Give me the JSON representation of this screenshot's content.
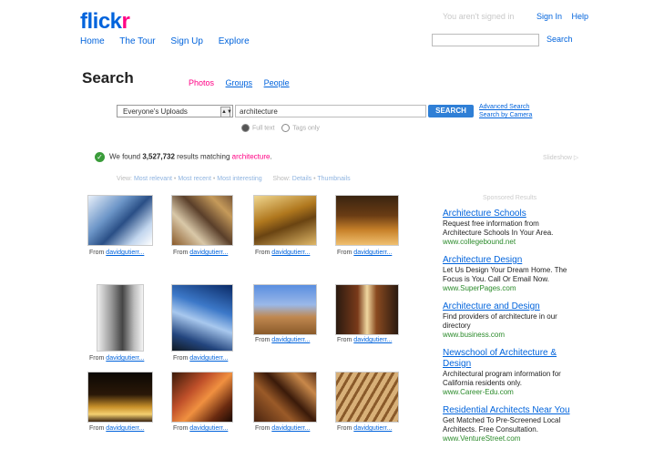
{
  "header": {
    "logo_main": "flick",
    "logo_accent": "r",
    "nav": [
      "Home",
      "The Tour",
      "Sign Up",
      "Explore"
    ],
    "signed_out": "You aren't signed in",
    "sign_in": "Sign In",
    "help": "Help",
    "search_button": "Search"
  },
  "search": {
    "title": "Search",
    "tabs": [
      {
        "label": "Photos",
        "active": true
      },
      {
        "label": "Groups",
        "active": false
      },
      {
        "label": "People",
        "active": false
      }
    ],
    "scope": "Everyone's Uploads",
    "query": "architecture",
    "button": "SEARCH",
    "advanced": "Advanced Search",
    "by_camera": "Search by Camera",
    "options": [
      "Full text",
      "Tags only"
    ]
  },
  "results": {
    "prefix": "We found",
    "count": "3,527,732",
    "mid": "results matching",
    "term": "architecture",
    "suffix": ".",
    "slideshow": "Slideshow",
    "view_label": "View:",
    "sort_relevant": "Most relevant",
    "sort_recent": "Most recent",
    "sort_interesting": "Most interesting",
    "show_label": "Show:",
    "show_details": "Details",
    "show_thumbs": "Thumbnails",
    "from_label": "From",
    "owner": "davidgutierr..."
  },
  "ads": {
    "label": "Sponsored Results",
    "items": [
      {
        "title": "Architecture Schools",
        "text": "Request free information from Architecture Schools In Your Area.",
        "url": "www.collegebound.net"
      },
      {
        "title": "Architecture Design",
        "text": "Let Us Design Your Dream Home. The Focus is You. Call Or Email Now.",
        "url": "www.SuperPages.com"
      },
      {
        "title": "Architecture and Design",
        "text": "Find providers of architecture in our directory",
        "url": "www.business.com"
      },
      {
        "title": "Newschool of Architecture & Design",
        "text": "Architectural program information for California residents only.",
        "url": "www.Career-Edu.com"
      },
      {
        "title": "Residential Architects Near You",
        "text": "Get Matched To Pre-Screened Local Architects. Free Consultation.",
        "url": "www.VentureStreet.com"
      }
    ]
  },
  "colors": {
    "link": "#0063dc",
    "accent": "#ff0084",
    "ad_url": "#2a8a2a",
    "search_button": "#2f7fd6"
  }
}
